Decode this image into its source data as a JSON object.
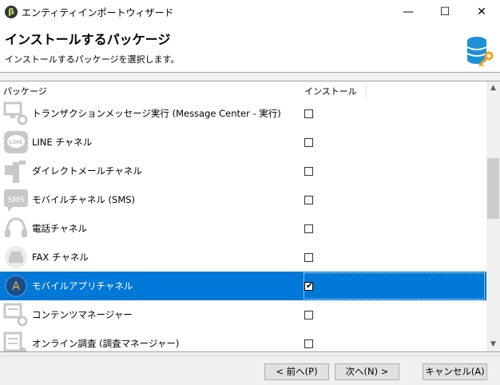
{
  "window": {
    "title": "エンティティインポートウィザード",
    "app_icon_glyph": "β",
    "minimize_glyph": "—",
    "maximize_glyph": "☐",
    "close_glyph": "✕"
  },
  "header": {
    "title": "インストールするパッケージ",
    "subtitle": "インストールするパッケージを選択します。"
  },
  "table": {
    "col_package": "パッケージ",
    "col_install": "インストール",
    "rows": [
      {
        "label": "トランザクションメッセージ実行 (Message Center - 実行)",
        "icon": "monitor-gear-icon",
        "checked": false
      },
      {
        "label": "LINE チャネル",
        "icon": "line-icon",
        "checked": false
      },
      {
        "label": "ダイレクトメールチャネル",
        "icon": "mailbox-icon",
        "checked": false
      },
      {
        "label": "モバイルチャネル (SMS)",
        "icon": "sms-icon",
        "checked": false
      },
      {
        "label": "電話チャネル",
        "icon": "headset-icon",
        "checked": false
      },
      {
        "label": "FAX チャネル",
        "icon": "fax-icon",
        "checked": false
      },
      {
        "label": "モバイルアプリチャネル",
        "icon": "mobile-app-icon",
        "checked": true,
        "selected": true
      },
      {
        "label": "コンテンツマネージャー",
        "icon": "content-manager-icon",
        "checked": false
      },
      {
        "label": "オンライン調査 (調査マネージャー)",
        "icon": "survey-icon",
        "checked": false
      }
    ]
  },
  "buttons": {
    "back": "< 前へ(P)",
    "next": "次へ(N) >",
    "cancel": "キャンセル(A)"
  },
  "colors": {
    "selection": "#0078d7",
    "icon_gray": "#c8c8c8",
    "db_blue": "#1e90d6",
    "key_orange": "#f0a020"
  }
}
